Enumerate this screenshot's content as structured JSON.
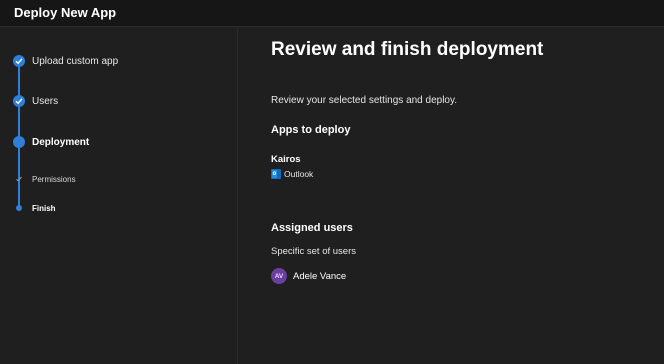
{
  "window": {
    "title": "Deploy New App"
  },
  "steps": [
    {
      "label": "Upload custom app",
      "state": "done"
    },
    {
      "label": "Users",
      "state": "done"
    },
    {
      "label": "Deployment",
      "state": "current"
    },
    {
      "label": "Permissions",
      "state": "done-sub"
    },
    {
      "label": "Finish",
      "state": "current-sub"
    }
  ],
  "main": {
    "heading": "Review and finish deployment",
    "description": "Review your selected settings and deploy.",
    "apps_section": {
      "title": "Apps to deploy",
      "app_name": "Kairos",
      "host_icon": "outlook-icon",
      "host_label": "Outlook"
    },
    "users_section": {
      "title": "Assigned users",
      "subtitle": "Specific set of users",
      "user": {
        "initials": "AV",
        "name": "Adele Vance"
      }
    }
  },
  "colors": {
    "accent": "#2f7fd8",
    "background": "#1f1f1f",
    "avatar": "#6b3fa0"
  }
}
